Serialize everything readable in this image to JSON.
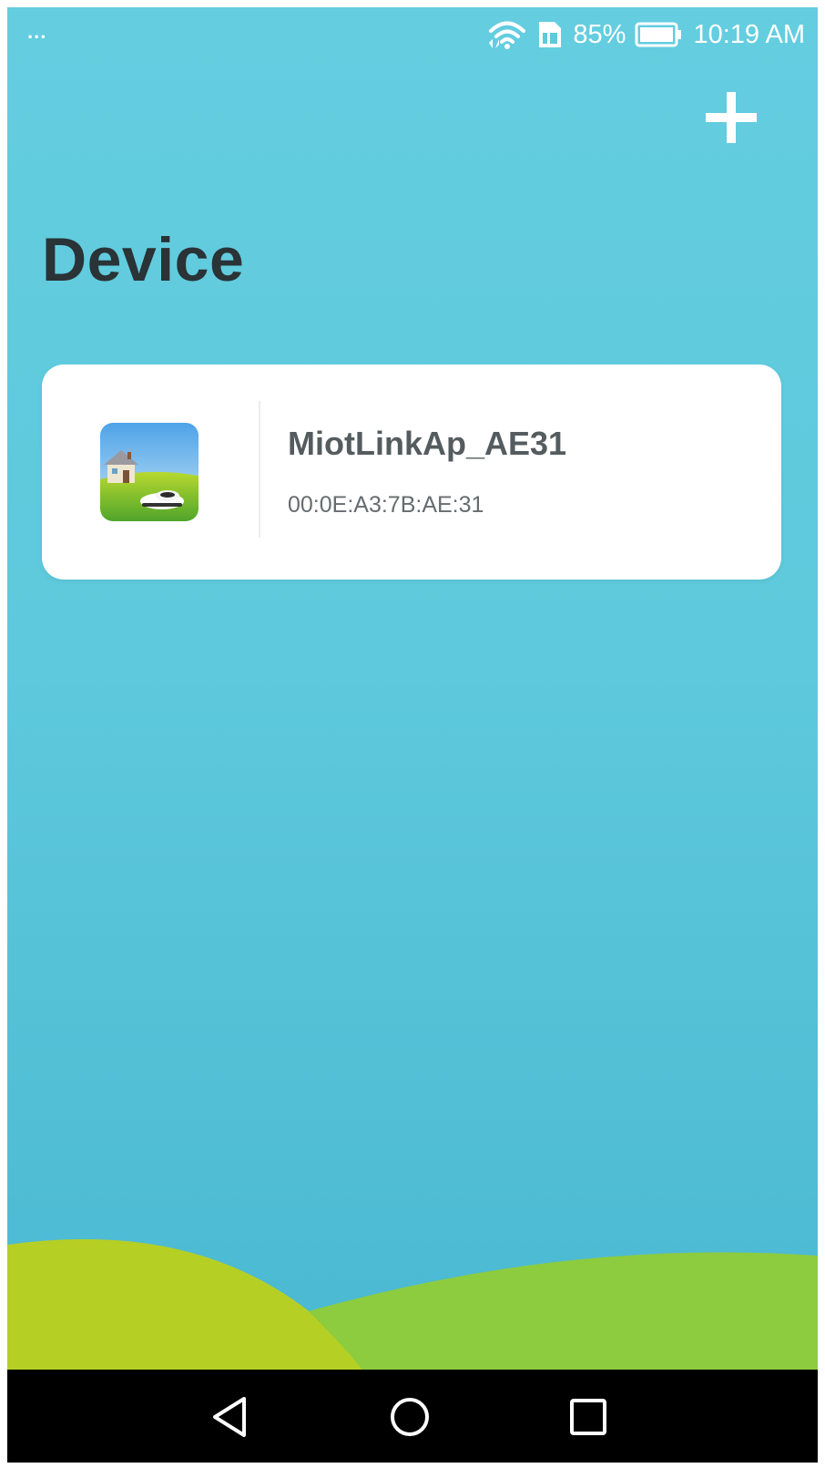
{
  "status_bar": {
    "notification_dots": "...",
    "battery_percent": "85%",
    "time": "10:19 AM",
    "icons": [
      "wifi-icon",
      "sim-icon",
      "battery-icon"
    ]
  },
  "header": {
    "add_icon": "plus-icon"
  },
  "page": {
    "title": "Device"
  },
  "device_list": [
    {
      "name": "MiotLinkAp_AE31",
      "mac": "00:0E:A3:7B:AE:31",
      "icon": "lawn-mower-house-icon"
    }
  ],
  "nav_bar": {
    "icons": [
      "back-icon",
      "home-icon",
      "recents-icon"
    ]
  },
  "colors": {
    "background_top": "#64cde0",
    "background_bottom": "#47b6d0",
    "title": "#2a3336",
    "card": "#ffffff",
    "hill_left": "#b6cf25",
    "hill_right": "#8ccc3e",
    "nav_bar": "#000000"
  }
}
